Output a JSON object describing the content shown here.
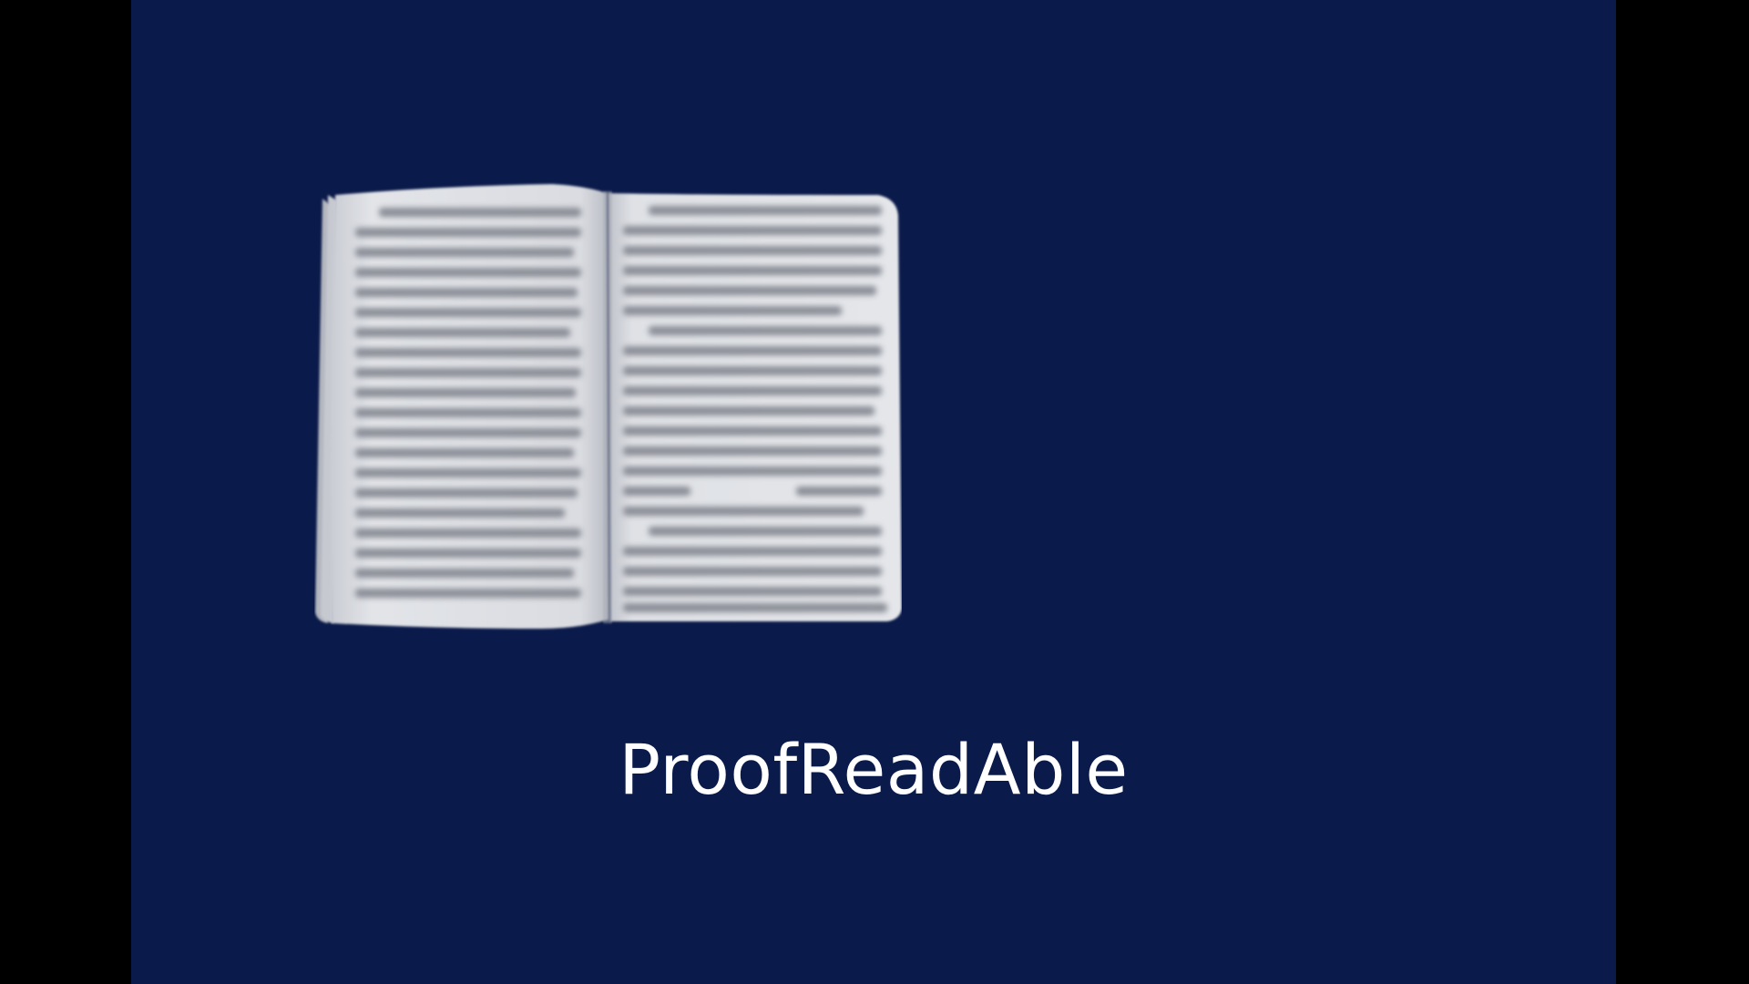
{
  "brand": {
    "name": "ProofReadAble"
  },
  "colors": {
    "background": "#0a1a4a",
    "letterbox": "#000000",
    "page": "#dcdee3",
    "text": "#ffffff"
  },
  "illustration": {
    "icon": "open-book-icon"
  }
}
